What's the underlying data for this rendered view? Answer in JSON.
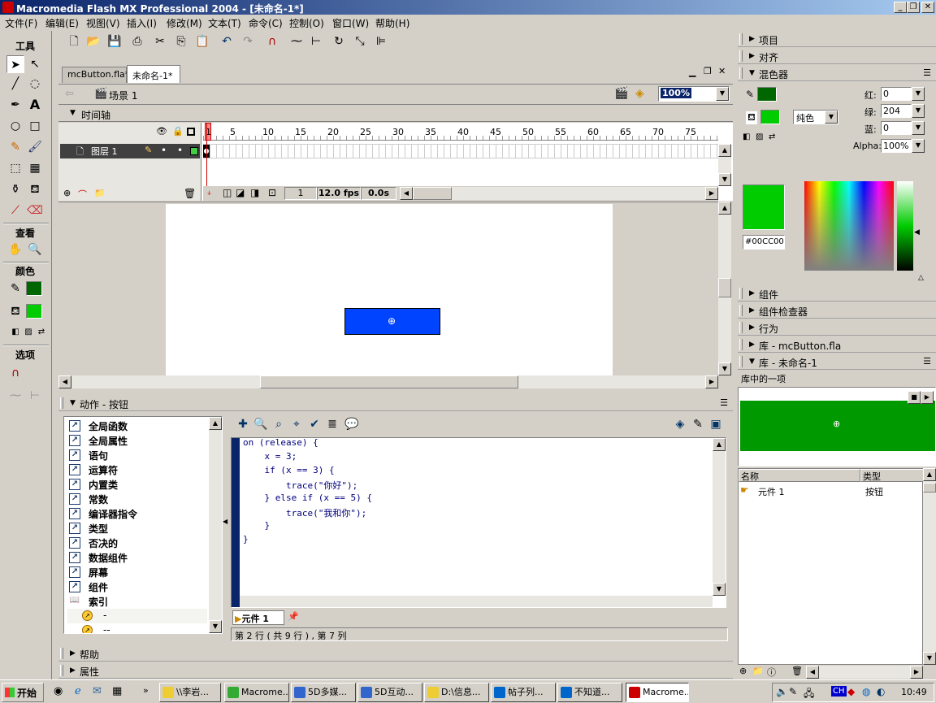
{
  "window": {
    "title": "Macromedia Flash MX Professional 2004 - [未命名-1*]"
  },
  "menu": [
    "文件(F)",
    "编辑(E)",
    "视图(V)",
    "插入(I)",
    "修改(M)",
    "文本(T)",
    "命令(C)",
    "控制(O)",
    "窗口(W)",
    "帮助(H)"
  ],
  "toolbox": {
    "title": "工具",
    "view_title": "查看",
    "color_title": "颜色",
    "options_title": "选项"
  },
  "doc_tabs": [
    "mcButton.fla*",
    "未命名-1*"
  ],
  "scene": {
    "label": "场景 1",
    "zoom": "100%"
  },
  "timeline": {
    "title": "时间轴",
    "layer": "图层 1",
    "frame_numbers": [
      "1",
      "5",
      "10",
      "15",
      "20",
      "25",
      "30",
      "35",
      "40",
      "45",
      "50",
      "55",
      "60",
      "65",
      "70",
      "75"
    ],
    "current_frame": "1",
    "fps": "12.0 fps",
    "time": "0.0s"
  },
  "actions": {
    "title": "动作 - 按钮",
    "categories": [
      "全局函数",
      "全局属性",
      "语句",
      "运算符",
      "内置类",
      "常数",
      "编译器指令",
      "类型",
      "否决的",
      "数据组件",
      "屏幕",
      "组件",
      "索引"
    ],
    "index_items": [
      "-",
      "--"
    ],
    "code_lines": [
      "on (release) {",
      "    x = 3;",
      "    if (x == 3) {",
      "        trace(\"你好\");",
      "    } else if (x == 5) {",
      "        trace(\"我和你\");",
      "    }",
      "}"
    ],
    "symbol_tab": "元件 1",
    "status": "第 2 行 ( 共 9 行 ) , 第 7 列"
  },
  "bottom_panels": {
    "help": "帮助",
    "props": "属性"
  },
  "right_panels": {
    "project": "项目",
    "align": "对齐",
    "mixer": "混色器",
    "components": "组件",
    "component_inspector": "组件检查器",
    "behaviors": "行为",
    "lib_mc": "库 - mcButton.fla",
    "lib_new": "库 - 未命名-1"
  },
  "mixer": {
    "r_label": "红:",
    "r": "0",
    "g_label": "绿:",
    "g": "204",
    "b_label": "蓝:",
    "b": "0",
    "alpha_label": "Alpha:",
    "alpha": "100%",
    "fill_type": "纯色",
    "hex": "#00CC00",
    "color": "#00cc00"
  },
  "library": {
    "count_text": "库中的一项",
    "col_name": "名称",
    "col_type": "类型",
    "items": [
      {
        "name": "元件 1",
        "type": "按钮"
      }
    ]
  },
  "taskbar": {
    "start": "开始",
    "tasks": [
      "\\\\李岩...",
      "Macrome...",
      "5D多媒...",
      "5D互动...",
      "D:\\信息...",
      "帖子列...",
      "不知道...",
      "Macrome..."
    ],
    "ime": "CH",
    "clock": "10:49"
  }
}
